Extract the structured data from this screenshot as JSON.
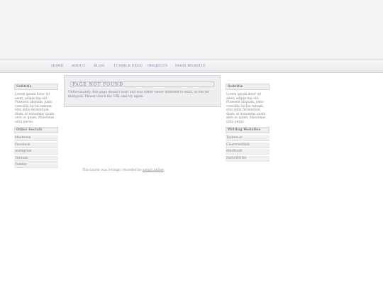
{
  "nav": {
    "items": [
      "HOME",
      "ABOUT",
      "BLOG",
      "TUMBLR FEED",
      "PROJECTS",
      "MAIN WEBSITE"
    ]
  },
  "left_sidebar": {
    "subtitle": "Subtitle",
    "text": "Lorem ipsum dolor sit amet, adipiscing elit. Praesent aliquam, justo convallis luctus rutrum, erat nulla fermentum diam, at nonummy quam ante ac quam. Maecenas urna purus.",
    "links_title": "Other Socials",
    "links": [
      "Mastodon",
      "Facebook",
      "Instagram",
      "Threads",
      "Tumblr"
    ]
  },
  "right_sidebar": {
    "subtitle": "Subtitle",
    "text": "Lorem ipsum dolor sit amet, adipiscing elit. Praesent aliquam, justo convallis luctus rutrum, erat nulla fermentum diam, at nonummy quam ante ac quam. Maecenas urna purus.",
    "links_title": "Writing Websites",
    "links": [
      "Toyhou.se",
      "CharacterHub",
      "ditoWoofs",
      "NaNoWriMo"
    ]
  },
  "main": {
    "title": "PAGE NOT FOUND",
    "message": "Unfortunately, this page doesn't exist and was either never intended to exist, or has be mistyped. Please check the URL and try again."
  },
  "footer": {
    "text": "This layout was lovingly recorded by ",
    "link": "sadgrl.online"
  }
}
